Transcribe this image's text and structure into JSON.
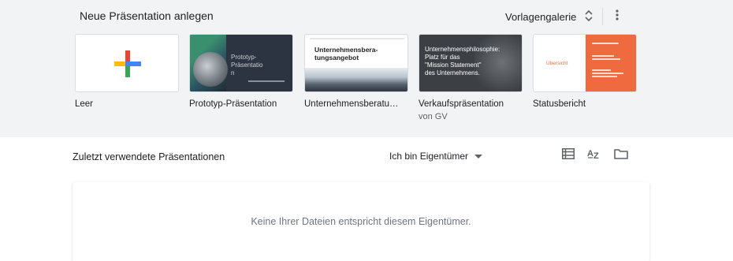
{
  "template_gallery": {
    "new_title": "Neue Präsentation anlegen",
    "gallery_label": "Vorlagengalerie",
    "templates": [
      {
        "label": "Leer",
        "sub": ""
      },
      {
        "label": "Prototyp-Präsentation",
        "sub": "",
        "thumb_text": "Prototyp-\nPräsentatio\nn"
      },
      {
        "label": "Unternehmensberatu…",
        "sub": "",
        "thumb_text": "Unternehmensbera-\ntungsangebot"
      },
      {
        "label": "Verkaufspräsentation",
        "sub": "von GV",
        "thumb_text": "Unternehmensphilosophie:\nPlatz für das\n\"Mission Statement\"\ndes Unternehmens."
      },
      {
        "label": "Statusbericht",
        "sub": "",
        "thumb_text": "Übersicht"
      }
    ]
  },
  "recent": {
    "title": "Zuletzt verwendete Präsentationen",
    "owner_filter": "Ich bin Eigentümer",
    "empty_message": "Keine Ihrer Dateien entspricht diesem Eigentümer."
  },
  "colors": {
    "top_bg": "#f1f3f4",
    "plus_blue": "#4285f4",
    "plus_red": "#ea4335",
    "plus_yellow": "#fbbc04",
    "plus_green": "#34a853",
    "status_orange": "#ef6a3e"
  },
  "icons": [
    "unfold-icon",
    "more-vert-icon",
    "dropdown-arrow-icon",
    "list-view-icon",
    "sort-az-icon",
    "folder-icon"
  ]
}
